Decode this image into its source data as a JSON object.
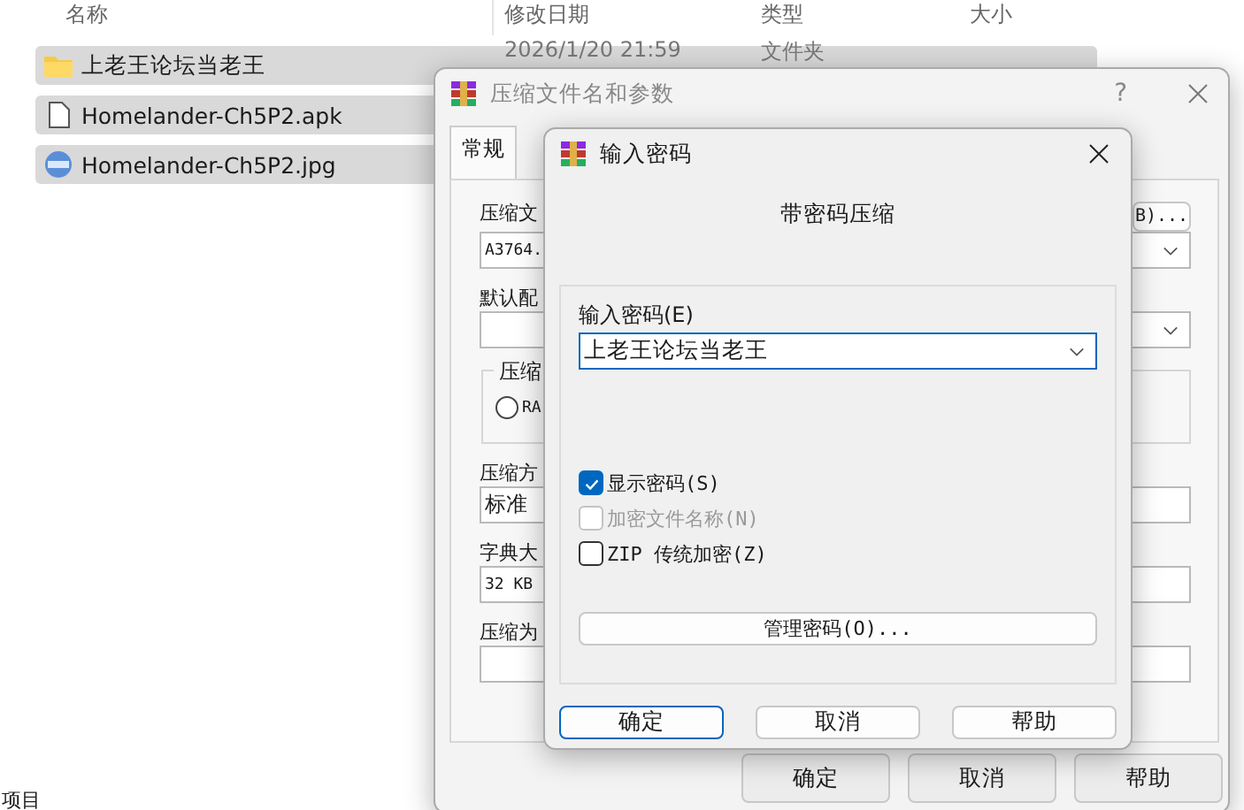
{
  "explorer": {
    "columns": [
      "名称",
      "修改日期",
      "类型",
      "大小"
    ],
    "rows": [
      {
        "kind": "folder",
        "name": "上老王论坛当老王",
        "date": "2026/1/20 21:59",
        "type": "文件夹",
        "selected": true
      },
      {
        "kind": "file",
        "name": "Homelander-Ch5P2.apk",
        "selected": true
      },
      {
        "kind": "image",
        "name": "Homelander-Ch5P2.jpg",
        "selected": true
      }
    ],
    "status_bar": "项目"
  },
  "archive_dialog": {
    "title": "压缩文件名和参数",
    "help": "?",
    "tabs": [
      {
        "label": "常规",
        "selected": true
      }
    ],
    "archive_name": {
      "label": "压缩文",
      "value": "A3764.",
      "browse": "B)..."
    },
    "profile": {
      "label": "默认配"
    },
    "format_group": {
      "label": "压缩",
      "radio": {
        "label": "RA",
        "selected": false
      }
    },
    "method": {
      "label": "压缩方",
      "value": "标准"
    },
    "dictionary": {
      "label": "字典大",
      "value": "32 KB"
    },
    "split": {
      "label": "压缩为"
    },
    "buttons": [
      "确定",
      "取消",
      "帮助"
    ]
  },
  "password_dialog": {
    "title": "输入密码",
    "heading": "带密码压缩",
    "password": {
      "label": "输入密码(E)",
      "value": "上老王论坛当老王"
    },
    "options": [
      {
        "label": "显示密码(S)",
        "checked": true,
        "disabled": false
      },
      {
        "label": "加密文件名称(N)",
        "checked": false,
        "disabled": true
      },
      {
        "label": "ZIP 传统加密(Z)",
        "checked": false,
        "disabled": false
      }
    ],
    "manage": "管理密码(O)...",
    "buttons": [
      {
        "label": "确定",
        "default": true
      },
      {
        "label": "取消",
        "default": false
      },
      {
        "label": "帮助",
        "default": false
      }
    ]
  }
}
